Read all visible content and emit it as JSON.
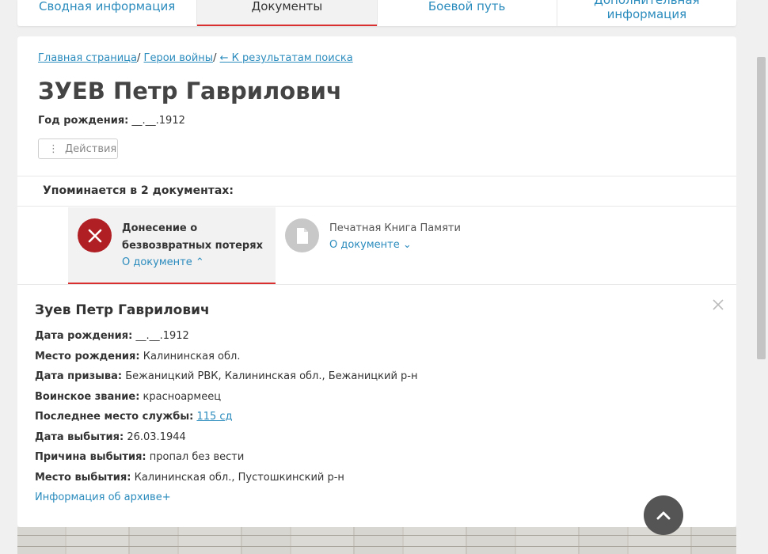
{
  "tabs": [
    {
      "label": "Сводная информация"
    },
    {
      "label": "Документы"
    },
    {
      "label": "Боевой путь"
    },
    {
      "label": "Дополнительная информация"
    }
  ],
  "breadcrumb": {
    "home": "Главная страница",
    "heroes": "Герои войны",
    "back": "← К результатам поиска",
    "sep": "/ "
  },
  "person": {
    "title": "ЗУЕВ Петр Гаврилович",
    "birth_label": "Год рождения:",
    "birth_value": "__.__.1912"
  },
  "actions_label": "Действия",
  "mentions": "Упоминается в 2 документах:",
  "documents": [
    {
      "name": "Донесение о безвозвратных потерях",
      "about": "О документе ⌃"
    },
    {
      "name": "Печатная Книга Памяти",
      "about": "О документе ⌄"
    }
  ],
  "record": {
    "name": "Зуев Петр Гаврилович",
    "rows": [
      {
        "label": "Дата рождения:",
        "value": "__.__.1912"
      },
      {
        "label": "Место рождения:",
        "value": "Калининская обл."
      },
      {
        "label": "Дата призыва:",
        "value": "Бежаницкий РВК, Калининская обл., Бежаницкий р-н"
      },
      {
        "label": "Воинское звание:",
        "value": "красноармеец"
      },
      {
        "label": "Последнее место службы:",
        "value": "115 сд"
      },
      {
        "label": "Дата выбытия:",
        "value": "26.03.1944"
      },
      {
        "label": "Причина выбытия:",
        "value": "пропал без вести"
      },
      {
        "label": "Место выбытия:",
        "value": "Калининская обл., Пустошкинский р-н"
      }
    ],
    "archive_link": "Информация об архиве+"
  },
  "icons": {
    "close": "close-icon",
    "cancel": "cancel-x-icon",
    "document": "document-icon",
    "scroll_top": "chevron-up-icon"
  },
  "colors": {
    "accent": "#d9302f",
    "link": "#2a8bbd",
    "loss_icon": "#b01f24",
    "doc_icon": "#c8c8c8"
  }
}
